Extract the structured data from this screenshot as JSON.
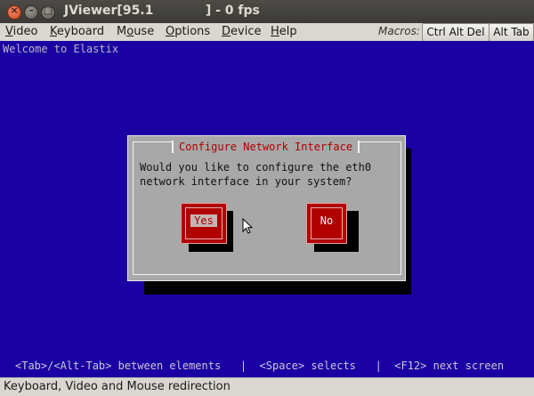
{
  "window": {
    "title": "JViewer[95.1            ] - 0 fps",
    "buttons": [
      "close",
      "minimize",
      "maximize"
    ]
  },
  "menubar": {
    "items": [
      {
        "label": "Video",
        "underline": "V"
      },
      {
        "label": "Keyboard",
        "underline": "K"
      },
      {
        "label": "Mouse",
        "underline": "o"
      },
      {
        "label": "Options",
        "underline": "O"
      },
      {
        "label": "Device",
        "underline": "D"
      },
      {
        "label": "Help",
        "underline": "H"
      }
    ],
    "macros_label": "Macros:",
    "macro_buttons": [
      "Ctrl Alt Del",
      "Alt Tab"
    ]
  },
  "console": {
    "welcome": "Welcome to Elastix",
    "background": "#1a00a2",
    "dialog": {
      "title": "Configure Network Interface",
      "message_lines": [
        "Would you like to configure the eth0",
        "network interface in your system?"
      ],
      "buttons": [
        {
          "label": "Yes",
          "focused": true
        },
        {
          "label": "No",
          "focused": false
        }
      ]
    },
    "hint": "<Tab>/<Alt-Tab> between elements   |  <Space> selects   |  <F12> next screen"
  },
  "statusbar": {
    "text": "Keyboard, Video and Mouse redirection"
  }
}
